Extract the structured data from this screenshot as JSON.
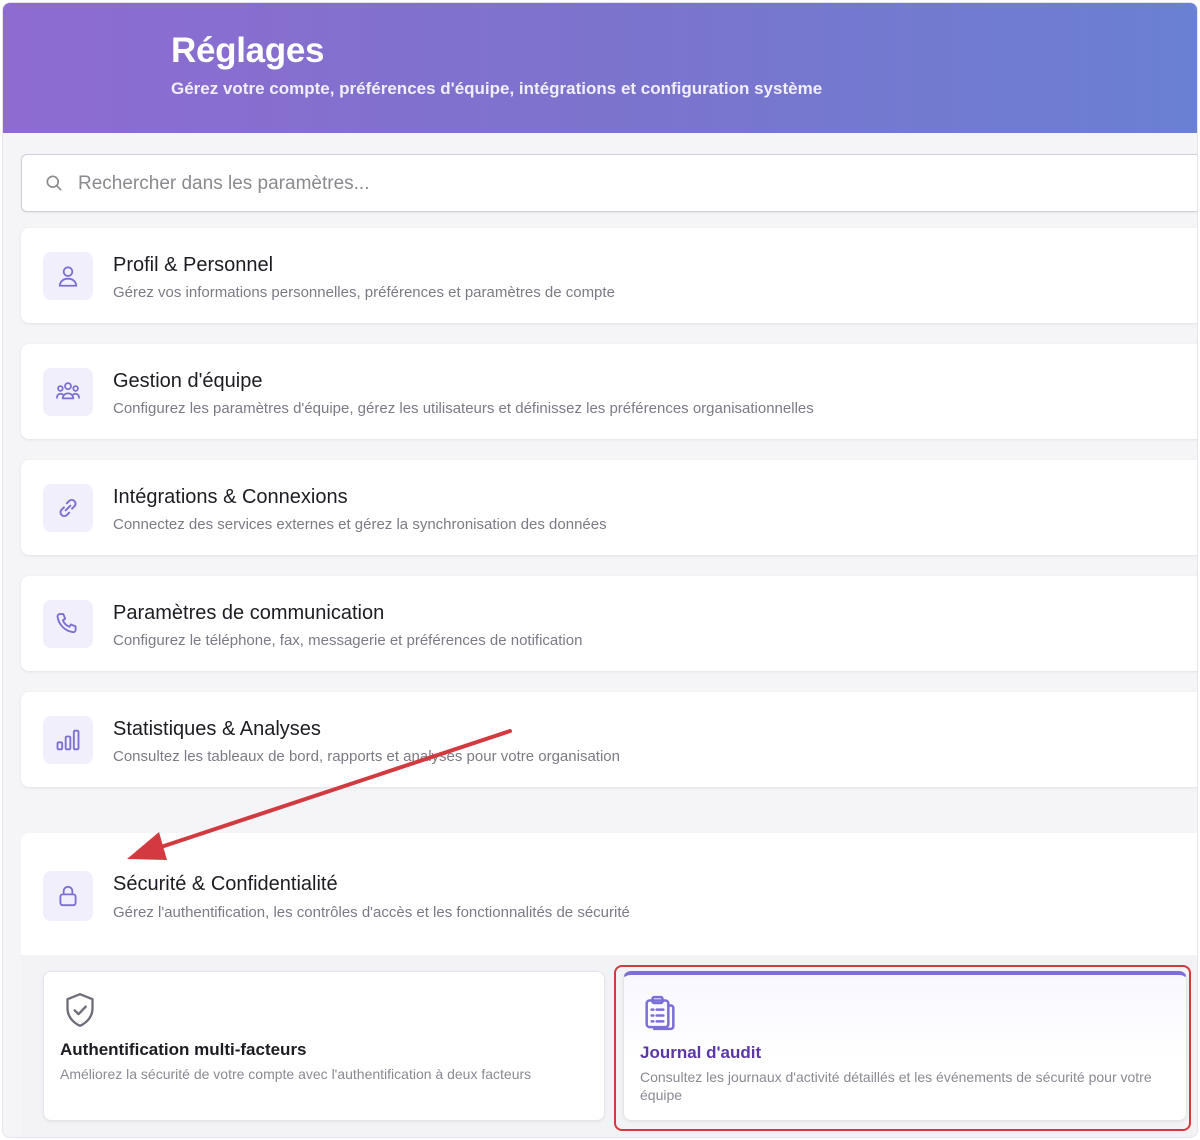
{
  "header": {
    "title": "Réglages",
    "subtitle": "Gérez votre compte, préférences d'équipe, intégrations et configuration système"
  },
  "search": {
    "placeholder": "Rechercher dans les paramètres...",
    "icon": "search-icon"
  },
  "sections": [
    {
      "icon": "user-icon",
      "title": "Profil & Personnel",
      "description": "Gérez vos informations personnelles, préférences et paramètres de compte"
    },
    {
      "icon": "team-icon",
      "title": "Gestion d'équipe",
      "description": "Configurez les paramètres d'équipe, gérez les utilisateurs et définissez les préférences organisationnelles"
    },
    {
      "icon": "link-icon",
      "title": "Intégrations & Connexions",
      "description": "Connectez des services externes et gérez la synchronisation des données"
    },
    {
      "icon": "phone-icon",
      "title": "Paramètres de communication",
      "description": "Configurez le téléphone, fax, messagerie et préférences de notification"
    },
    {
      "icon": "chart-icon",
      "title": "Statistiques & Analyses",
      "description": "Consultez les tableaux de bord, rapports et analyses pour votre organisation"
    }
  ],
  "security": {
    "icon": "lock-icon",
    "title": "Sécurité & Confidentialité",
    "description": "Gérez l'authentification, les contrôles d'accès et les fonctionnalités de sécurité",
    "options": [
      {
        "icon": "shield-check-icon",
        "title": "Authentification multi-facteurs",
        "description": "Améliorez la sécurité de votre compte avec l'authentification à deux facteurs",
        "selected": false
      },
      {
        "icon": "clipboard-list-icon",
        "title": "Journal d'audit",
        "description": "Consultez les journaux d'activité détaillés et les événements de sécurité pour votre équipe",
        "selected": true
      }
    ]
  },
  "colors": {
    "accent": "#7c73cd",
    "icon": "#7b6fd6",
    "annotation": "#d33a3f"
  }
}
